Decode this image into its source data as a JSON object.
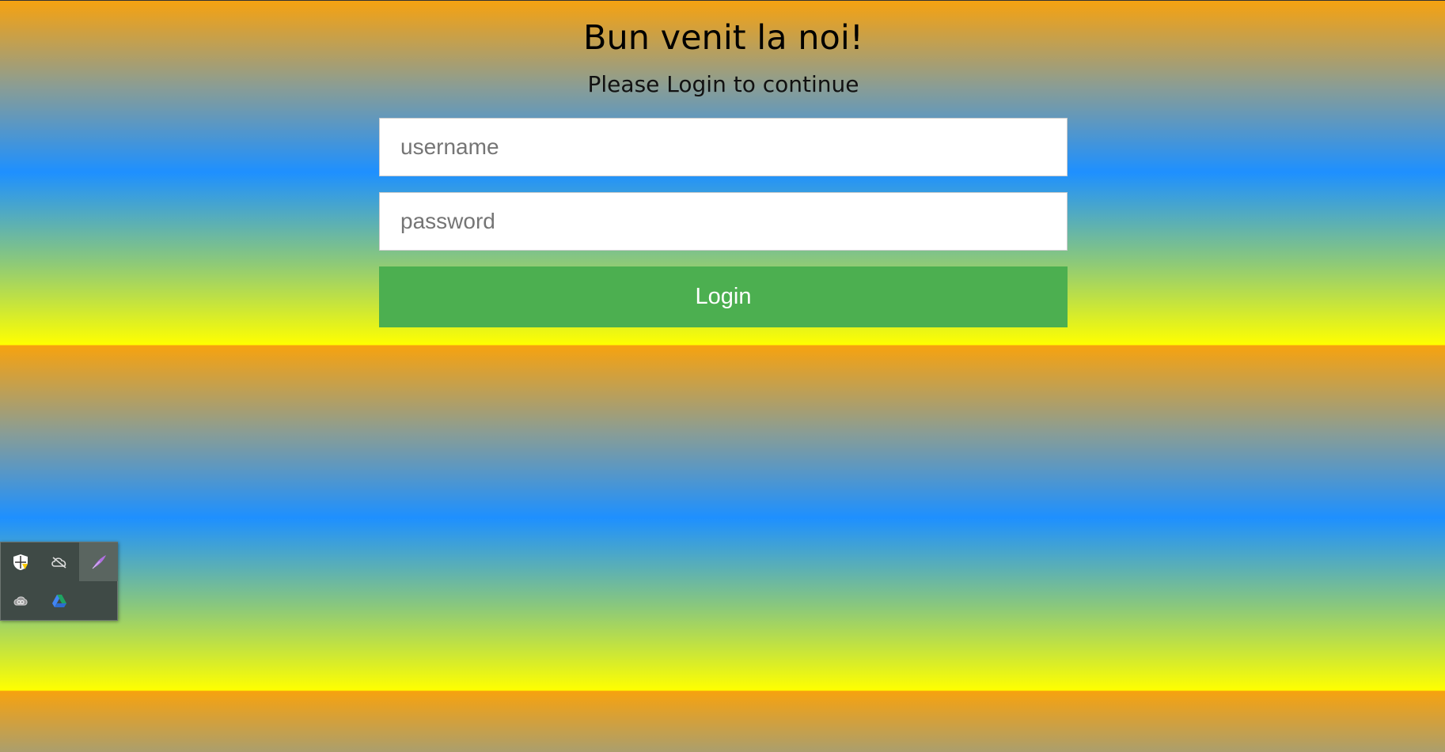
{
  "header": {
    "title": "Bun venit la noi!",
    "subtitle": "Please Login to continue"
  },
  "form": {
    "username_placeholder": "username",
    "password_placeholder": "password",
    "login_label": "Login"
  },
  "tray": {
    "icons": [
      "security-shield-icon",
      "cloud-offline-icon",
      "feather-pen-icon",
      "creative-cloud-icon",
      "drive-icon"
    ]
  },
  "colors": {
    "button": "#4caf50",
    "gradient": [
      "#f7a20f",
      "#1e90ff",
      "#ffff00"
    ]
  }
}
